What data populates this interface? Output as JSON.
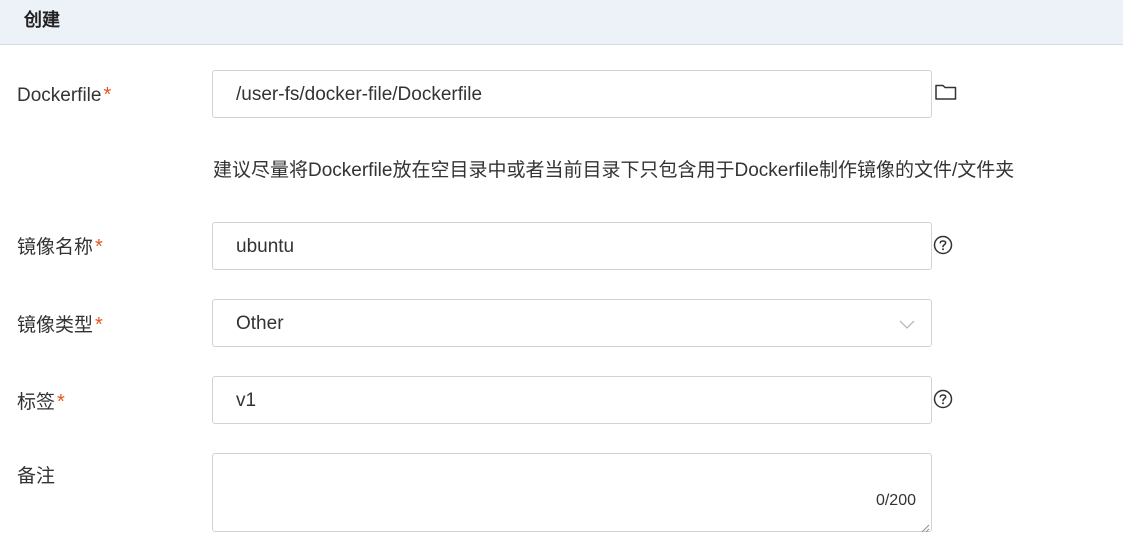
{
  "header": {
    "title": "创建"
  },
  "form": {
    "required_mark": "*",
    "dockerfile": {
      "label": "Dockerfile",
      "value": "/user-fs/docker-file/Dockerfile",
      "icon": "folder-icon"
    },
    "hint": "建议尽量将Dockerfile放在空目录中或者当前目录下只包含用于Dockerfile制作镜像的文件/文件夹",
    "image_name": {
      "label": "镜像名称",
      "value": "ubuntu",
      "icon": "help-circle-icon"
    },
    "image_type": {
      "label": "镜像类型",
      "selected": "Other",
      "icon": "chevron-down-icon"
    },
    "tag": {
      "label": "标签",
      "value": "v1",
      "icon": "help-circle-icon"
    },
    "remark": {
      "label": "备注",
      "value": "",
      "counter": "0/200"
    }
  },
  "colors": {
    "header_bg": "#edf1f8",
    "required": "#e8541e",
    "border": "#cfd3da",
    "text": "#333333"
  }
}
